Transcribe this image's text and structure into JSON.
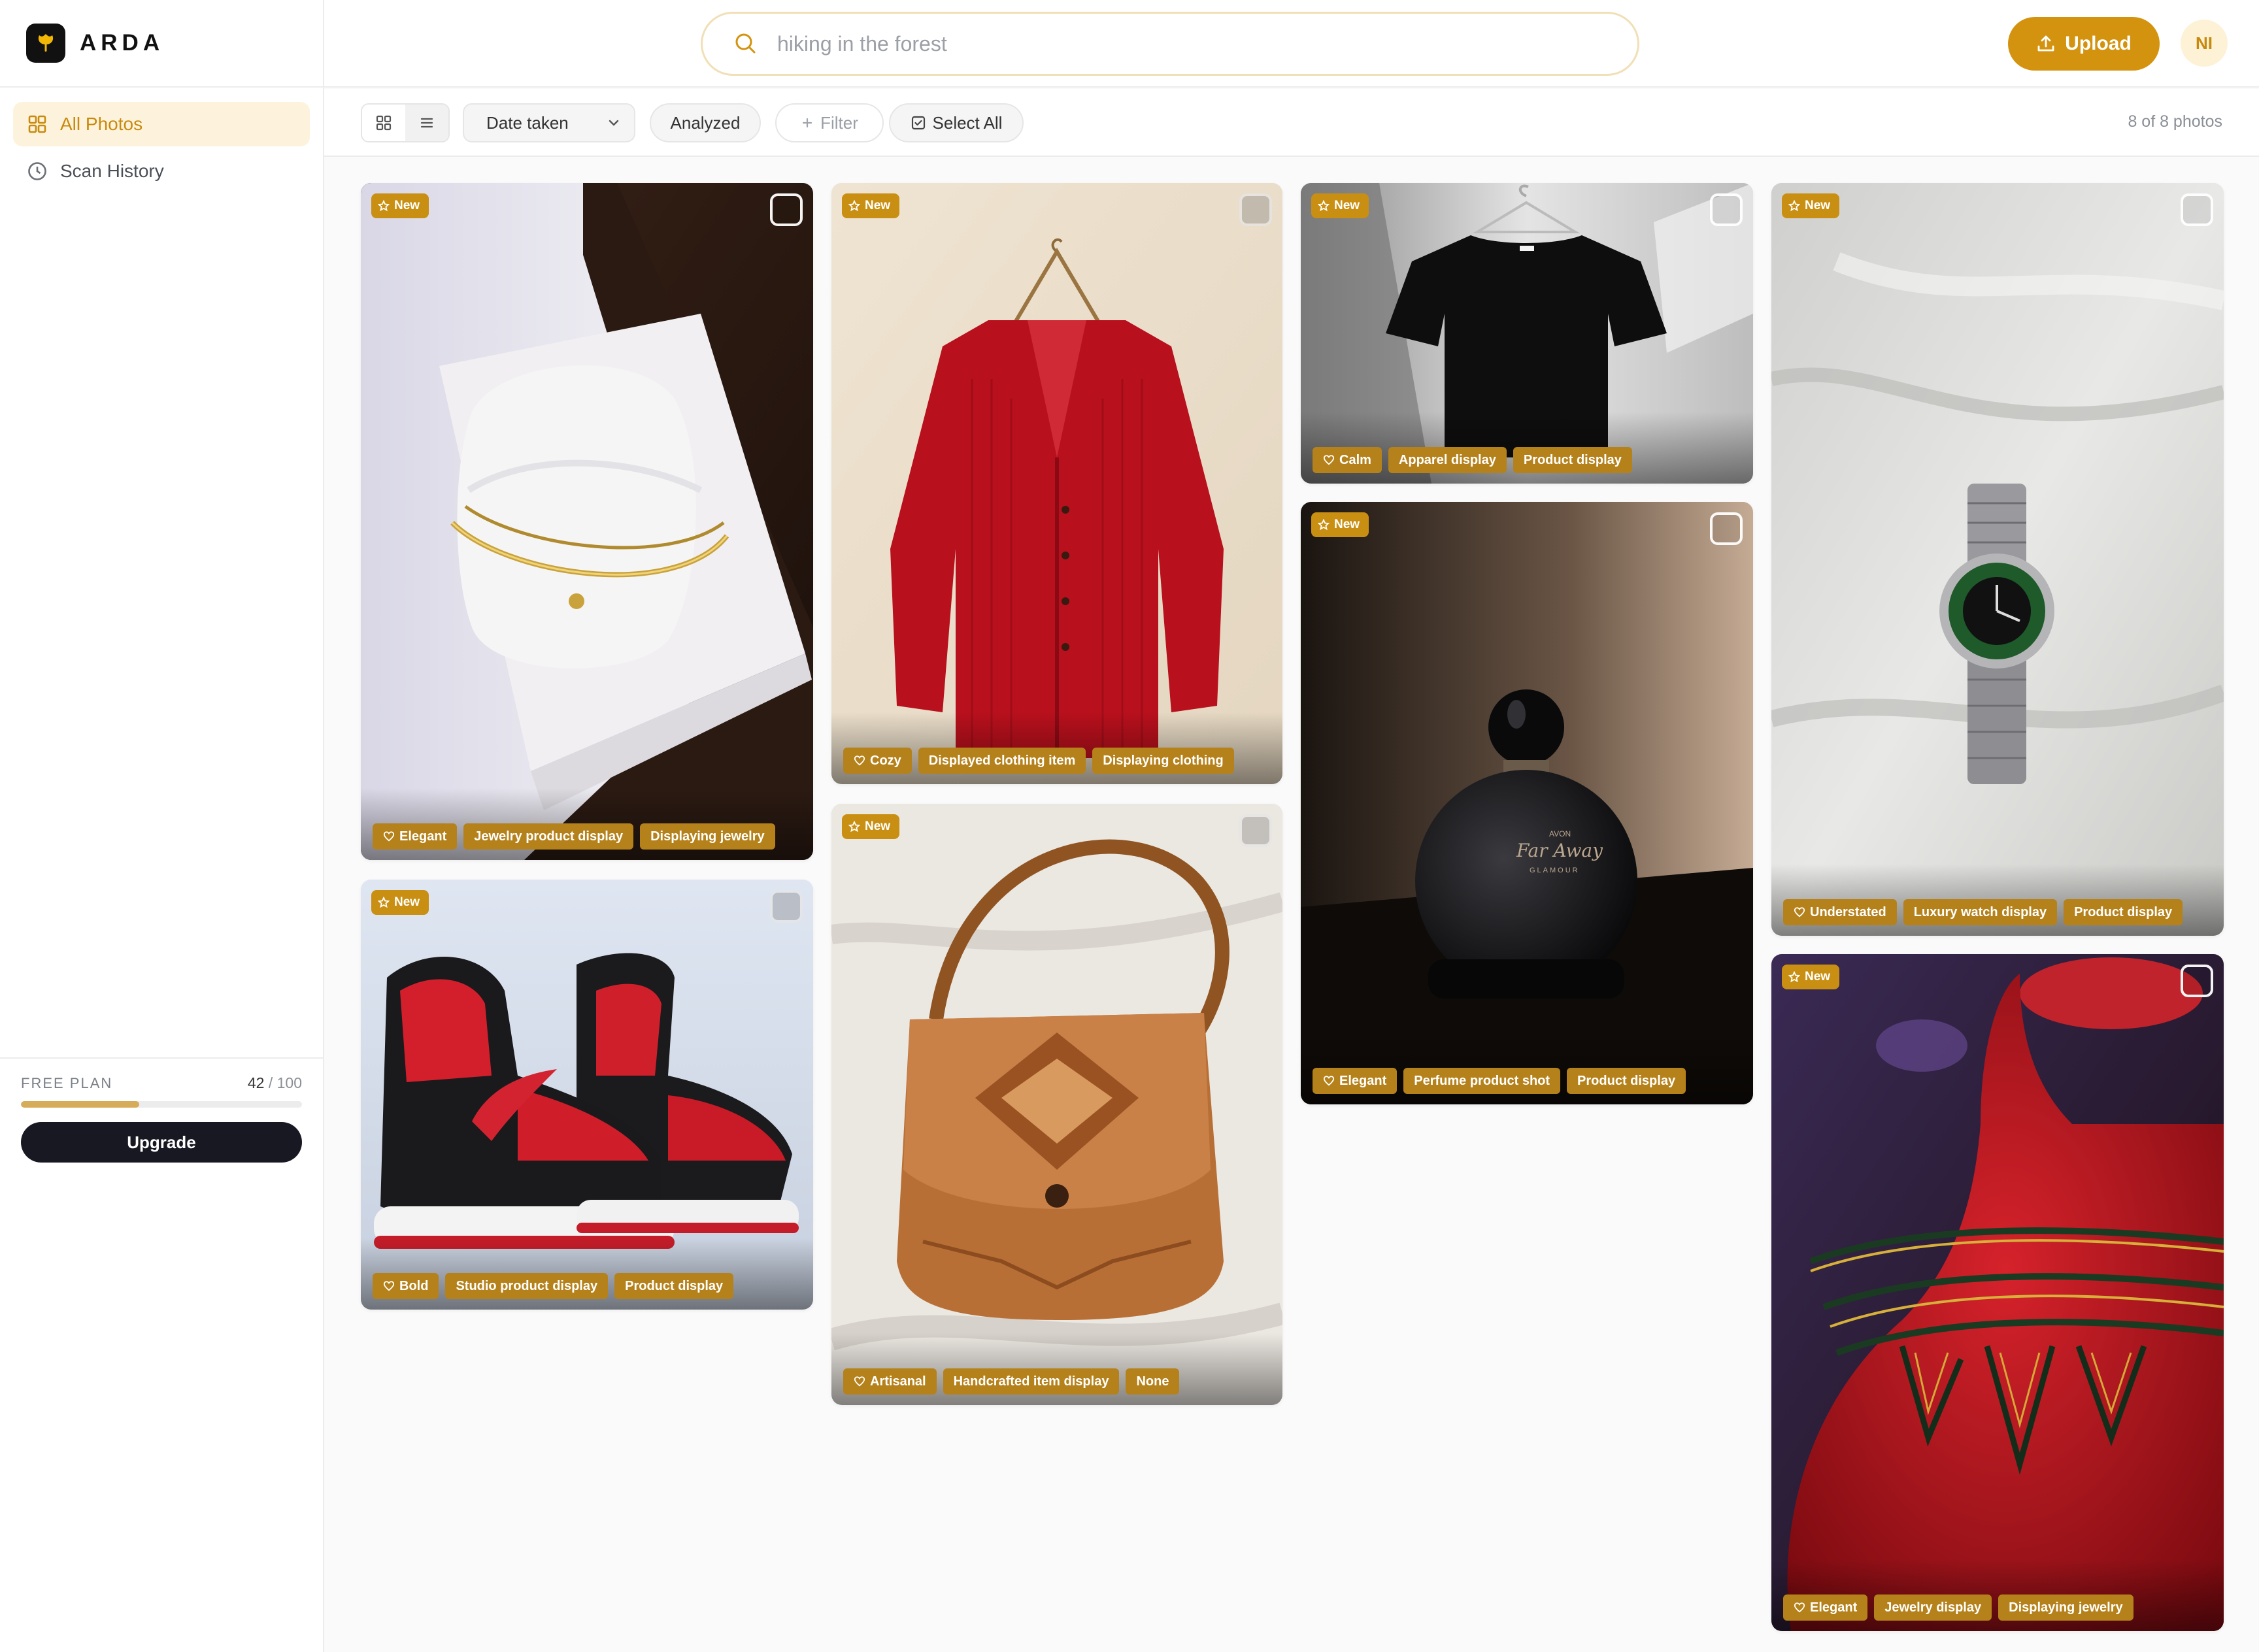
{
  "app": {
    "name": "ARDA"
  },
  "sidebar": {
    "items": [
      {
        "label": "All Photos",
        "icon": "grid-icon",
        "active": true
      },
      {
        "label": "Scan History",
        "icon": "clock-icon",
        "active": false
      }
    ],
    "plan": {
      "label": "FREE PLAN",
      "used": "42",
      "limit": "/ 100",
      "usage_fraction": 0.42,
      "upgrade_label": "Upgrade"
    }
  },
  "header": {
    "search": {
      "placeholder": "hiking in the forest",
      "value": ""
    },
    "upload_label": "Upload",
    "avatar_initials": "NI"
  },
  "toolbar": {
    "sort_label": "Date taken",
    "analyzed_label": "Analyzed",
    "filter_label": "Filter",
    "select_all_label": "Select All",
    "count_text": "8 of 8 photos"
  },
  "colors": {
    "accent": "#d4930f",
    "badge": "#c98f12",
    "tag": "#b5811b",
    "dark_button": "#171821"
  },
  "photos": [
    {
      "badge": "New",
      "subject": "gold bracelet on white pillow",
      "tags": [
        "Elegant",
        "Jewelry product display",
        "Displaying jewelry"
      ]
    },
    {
      "badge": "New",
      "subject": "red and black sneakers",
      "tags": [
        "Bold",
        "Studio product display",
        "Product display"
      ]
    },
    {
      "badge": "New",
      "subject": "red cardigan on hanger",
      "tags": [
        "Cozy",
        "Displayed clothing item",
        "Displaying clothing"
      ]
    },
    {
      "badge": "New",
      "subject": "tooled leather bag",
      "tags": [
        "Artisanal",
        "Handcrafted item display",
        "None"
      ]
    },
    {
      "badge": "New",
      "subject": "black t-shirt on hanger",
      "tags": [
        "Calm",
        "Apparel display",
        "Product display"
      ]
    },
    {
      "badge": "New",
      "subject": "black perfume bottle",
      "tags": [
        "Elegant",
        "Perfume product shot",
        "Product display"
      ],
      "bottle_text": [
        "AVON",
        "Far Away",
        "GLAMOUR"
      ]
    },
    {
      "badge": "New",
      "subject": "wristwatch on white sheet",
      "tags": [
        "Understated",
        "Luxury watch display",
        "Product display"
      ]
    },
    {
      "badge": "New",
      "subject": "beaded necklace on red bust",
      "tags": [
        "Elegant",
        "Jewelry display",
        "Displaying jewelry"
      ]
    }
  ]
}
